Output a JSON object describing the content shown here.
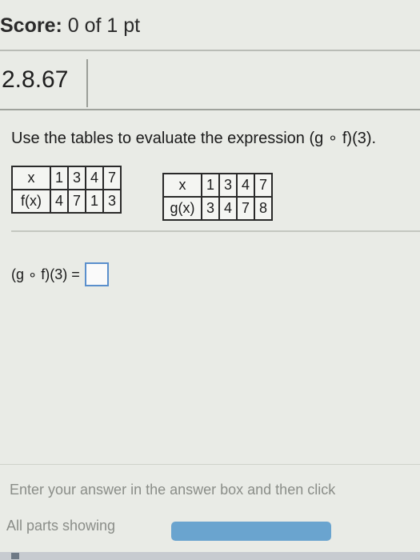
{
  "score": {
    "label": "Score:",
    "value": "0 of 1 pt"
  },
  "question": {
    "number": "2.8.67",
    "prompt": "Use the tables to evaluate the expression (g ∘ f)(3)."
  },
  "tables": {
    "f": {
      "x_header": "x",
      "y_header": "f(x)",
      "x_values": [
        "1",
        "3",
        "4",
        "7"
      ],
      "y_values": [
        "4",
        "7",
        "1",
        "3"
      ]
    },
    "g": {
      "x_header": "x",
      "y_header": "g(x)",
      "x_values": [
        "1",
        "3",
        "4",
        "7"
      ],
      "y_values": [
        "3",
        "4",
        "7",
        "8"
      ]
    }
  },
  "answer": {
    "expression": "(g ∘ f)(3) =",
    "value": ""
  },
  "footer": {
    "instruction": "Enter your answer in the answer box and then click",
    "parts": "All parts showing",
    "progress": 1.0
  },
  "colors": {
    "answer_box_border": "#5a8fcc",
    "progress_fill": "#6aa4cf"
  }
}
